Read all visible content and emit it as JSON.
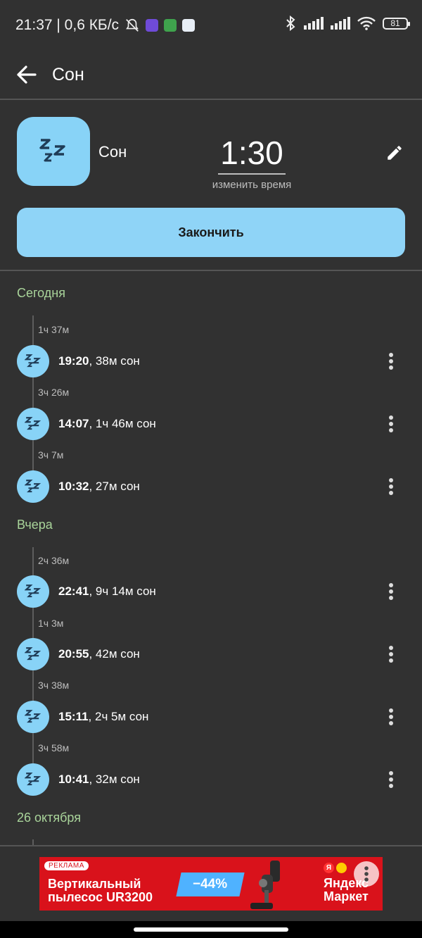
{
  "status_bar": {
    "time_and_speed": "21:37 | 0,6 КБ/с",
    "battery": "81"
  },
  "app_bar": {
    "title": "Сон",
    "back_icon": "arrow-left-icon"
  },
  "current": {
    "name": "Сон",
    "timer": "1:30",
    "timer_hint": "изменить время",
    "finish_label": "Закончить",
    "icon": "zzz-sleep-icon",
    "accent_color": "#88d3f7"
  },
  "sections": [
    {
      "title": "Сегодня",
      "items": [
        {
          "gap": "1ч 37м",
          "time": "19:20",
          "detail": ", 38м сон"
        },
        {
          "gap": "3ч 26м",
          "time": "14:07",
          "detail": ", 1ч 46м сон"
        },
        {
          "gap": "3ч 7м",
          "time": "10:32",
          "detail": ", 27м сон"
        }
      ]
    },
    {
      "title": "Вчера",
      "items": [
        {
          "gap": "2ч 36м",
          "time": "22:41",
          "detail": ", 9ч 14м сон"
        },
        {
          "gap": "1ч 3м",
          "time": "20:55",
          "detail": ", 42м сон"
        },
        {
          "gap": "3ч 38м",
          "time": "15:11",
          "detail": ", 2ч 5м сон"
        },
        {
          "gap": "3ч 58м",
          "time": "10:41",
          "detail": ", 32м сон"
        }
      ]
    },
    {
      "title": "26 октября",
      "items": []
    }
  ],
  "ad": {
    "label": "РЕКЛАМА",
    "title_line1": "Вертикальный",
    "title_line2": "пылесос UR3200",
    "discount": "−44%",
    "brand_line1": "Яндекс",
    "brand_line2": "Маркет",
    "brand_badge": "Я"
  },
  "colors": {
    "background": "#313131",
    "section_header": "#a9d49a",
    "accent": "#88d3f7",
    "ad_red": "#d9121b"
  }
}
